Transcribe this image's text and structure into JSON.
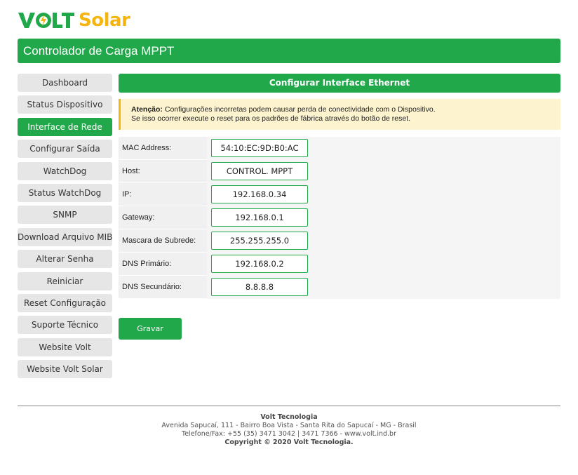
{
  "brand": {
    "logo_volt": "VOLT",
    "logo_solar": "Solar",
    "green": "#21a84a",
    "yellow": "#f6b40e"
  },
  "header": {
    "title": "Controlador de Carga MPPT"
  },
  "sidebar": {
    "items": [
      {
        "label": "Dashboard",
        "active": false
      },
      {
        "label": "Status Dispositivo",
        "active": false
      },
      {
        "label": "Interface de Rede",
        "active": true
      },
      {
        "label": "Configurar Saída",
        "active": false
      },
      {
        "label": "WatchDog",
        "active": false
      },
      {
        "label": "Status WatchDog",
        "active": false
      },
      {
        "label": "SNMP",
        "active": false
      },
      {
        "label": "Download Arquivo MIB",
        "active": false
      },
      {
        "label": "Alterar Senha",
        "active": false
      },
      {
        "label": "Reiniciar",
        "active": false
      },
      {
        "label": "Reset Configuração",
        "active": false
      },
      {
        "label": "Suporte Técnico",
        "active": false
      },
      {
        "label": "Website Volt",
        "active": false
      },
      {
        "label": "Website Volt Solar",
        "active": false
      }
    ]
  },
  "panel": {
    "title": "Configurar Interface Ethernet",
    "warning": {
      "bold": "Atenção:",
      "line1": " Configurações incorretas podem causar perda de conectividade com o Dispositivo.",
      "line2": "Se isso ocorrer execute o reset para os padrões de fábrica através do botão de reset."
    },
    "fields": [
      {
        "label": "MAC Address:",
        "value": "54:10:EC:9D:B0:AC"
      },
      {
        "label": "Host:",
        "value": "CONTROL. MPPT"
      },
      {
        "label": "IP:",
        "value": "192.168.0.34"
      },
      {
        "label": "Gateway:",
        "value": "192.168.0.1"
      },
      {
        "label": "Mascara de Subrede:",
        "value": "255.255.255.0"
      },
      {
        "label": "DNS Primário:",
        "value": "192.168.0.2"
      },
      {
        "label": "DNS Secundário:",
        "value": "8.8.8.8"
      }
    ],
    "save_label": "Gravar"
  },
  "footer": {
    "company": "Volt Tecnologia",
    "address": "Avenida Sapucaí, 111 - Bairro Boa Vista - Santa Rita do Sapucaí - MG - Brasil",
    "contact": "Telefone/Fax: +55 (35) 3471 3042 | 3471 7366 - www.volt.ind.br",
    "copyright": "Copyright © 2020 Volt Tecnologia."
  }
}
